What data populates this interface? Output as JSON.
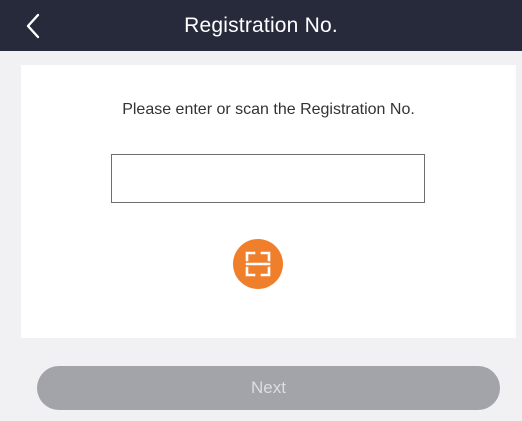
{
  "header": {
    "title": "Registration No.",
    "back_icon": "chevron-left-icon"
  },
  "form": {
    "prompt": "Please enter or scan the Registration No.",
    "registration_input_value": "",
    "registration_input_placeholder": "",
    "scan_icon": "scan-frame-icon"
  },
  "footer": {
    "next_label": "Next",
    "next_enabled": false
  },
  "colors": {
    "nav_bar": "#262a3b",
    "scan_button": "#f07f2c",
    "next_button_disabled": "#a3a4a9",
    "background": "#f1f1f3"
  }
}
